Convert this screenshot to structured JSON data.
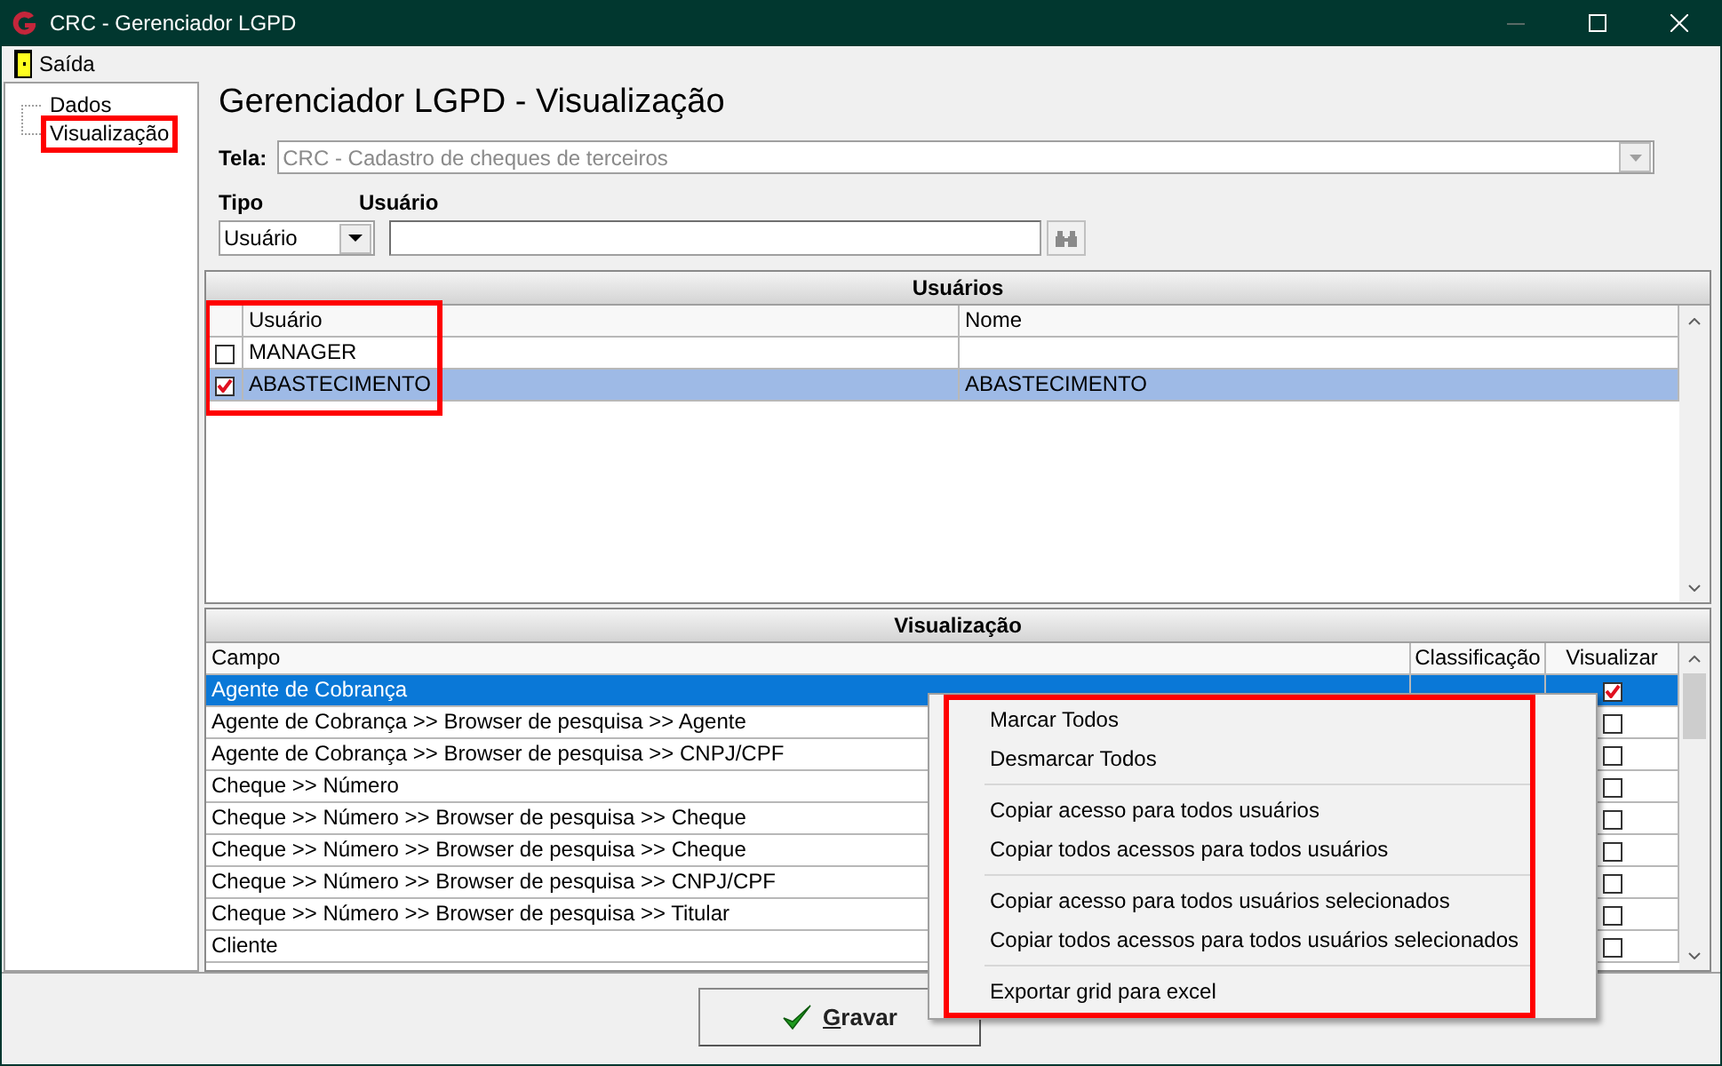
{
  "window": {
    "title": "CRC - Gerenciador LGPD"
  },
  "menu": [
    {
      "label": "Saída"
    }
  ],
  "sidebar": {
    "items": [
      {
        "label": "Dados",
        "selected": false
      },
      {
        "label": "Visualização",
        "selected": true
      }
    ]
  },
  "heading": "Gerenciador LGPD - Visualização",
  "tela": {
    "label": "Tela:",
    "value": "CRC - Cadastro de cheques de terceiros",
    "disabled": true
  },
  "filters": {
    "tipo_label": "Tipo",
    "tipo_value": "Usuário",
    "usuario_label": "Usuário"
  },
  "users": {
    "title": "Usuários",
    "columns": [
      "Usuário",
      "Nome"
    ],
    "rows": [
      {
        "usuario": "MANAGER",
        "checked": false,
        "selected": false
      },
      {
        "usuario": "ABASTECIMENTO",
        "nome": "ABASTECIMENTO",
        "checked": true,
        "selected": true
      }
    ]
  },
  "fields": {
    "title": "Visualização",
    "columns": [
      "Campo",
      "Classificação",
      "Visualizar"
    ],
    "rows": [
      {
        "campo": "Agente de Cobrança",
        "visualizar": true,
        "selected": true
      },
      {
        "campo": "Agente de Cobrança >> Browser de pesquisa >> Agente",
        "visualizar": false,
        "selected": false
      },
      {
        "campo": "Agente de Cobrança >> Browser de pesquisa >> CNPJ/CPF",
        "visualizar": false,
        "selected": false
      },
      {
        "campo": "Cheque >> Número",
        "visualizar": false,
        "selected": false
      },
      {
        "campo": "Cheque >> Número >> Browser de pesquisa >> Cheque",
        "visualizar": false,
        "selected": false
      },
      {
        "campo": "Cheque >> Número >> Browser de pesquisa >> Cheque",
        "visualizar": false,
        "selected": false
      },
      {
        "campo": "Cheque >> Número >> Browser de pesquisa >> CNPJ/CPF",
        "visualizar": false,
        "selected": false
      },
      {
        "campo": "Cheque >> Número >> Browser de pesquisa >> Titular",
        "visualizar": false,
        "selected": false
      },
      {
        "campo": "Cliente",
        "visualizar": false,
        "selected": false
      }
    ]
  },
  "context_menu": {
    "groups": [
      [
        "Marcar Todos",
        "Desmarcar Todos"
      ],
      [
        "Copiar acesso para todos usuários",
        "Copiar todos acessos para todos usuários"
      ],
      [
        "Copiar acesso para todos usuários selecionados",
        "Copiar todos acessos para todos usuários selecionados"
      ],
      [
        "Exportar grid para excel"
      ]
    ]
  },
  "save_button": {
    "label": "Gravar"
  }
}
